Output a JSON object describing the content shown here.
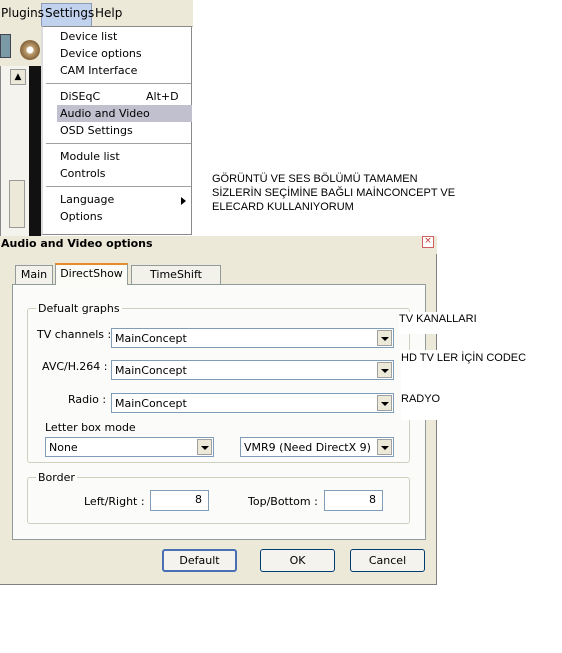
{
  "menubar": {
    "items": [
      "Plugins",
      "Settings",
      "Help"
    ]
  },
  "settings_menu": {
    "items": [
      {
        "label": "Device list"
      },
      {
        "label": "Device options"
      },
      {
        "label": "CAM Interface"
      },
      {
        "label": "DiSEqC",
        "shortcut": "Alt+D"
      },
      {
        "label": "Audio and Video",
        "highlighted": true
      },
      {
        "label": "OSD Settings"
      },
      {
        "label": "Module list"
      },
      {
        "label": "Controls"
      },
      {
        "label": "Language",
        "submenu": true
      },
      {
        "label": "Options"
      }
    ]
  },
  "annotations": {
    "note_lines": [
      "GÖRÜNTÜ VE SES BÖLÜMÜ TAMAMEN",
      "SİZLERİN SEÇİMİNE BAĞLI MAİNCONCEPT VE",
      "ELECARD KULLANIYORUM"
    ],
    "tv_channels_note": "TV KANALLARI",
    "hd_note": "HD TV LER İÇİN CODEC",
    "radio_note": "RADYO"
  },
  "dialog": {
    "title": "Audio and Video options",
    "close_symbol": "×",
    "tabs": [
      {
        "label": "Main"
      },
      {
        "label": "DirectShow",
        "selected": true
      },
      {
        "label": "TimeShift buffer"
      }
    ],
    "default_graphs": {
      "legend": "Defualt graphs",
      "tv_channels_label": "TV channels :",
      "tv_channels_value": "MainConcept",
      "avc_label": "AVC/H.264 :",
      "avc_value": "MainConcept",
      "radio_label": "Radio :",
      "radio_value": "MainConcept",
      "letterbox_label": "Letter box mode",
      "letterbox_value": "None",
      "renderer_value": "VMR9 (Need DirectX 9)"
    },
    "border": {
      "legend": "Border",
      "left_right_label": "Left/Right :",
      "left_right_value": "8",
      "top_bottom_label": "Top/Bottom :",
      "top_bottom_value": "8"
    },
    "buttons": {
      "default": "Default",
      "ok": "OK",
      "cancel": "Cancel"
    }
  },
  "colors": {
    "menu_highlight": "#c0c0ce",
    "selected_tab_accent": "#e68b2c",
    "dialog_bg": "#ece9d8"
  }
}
